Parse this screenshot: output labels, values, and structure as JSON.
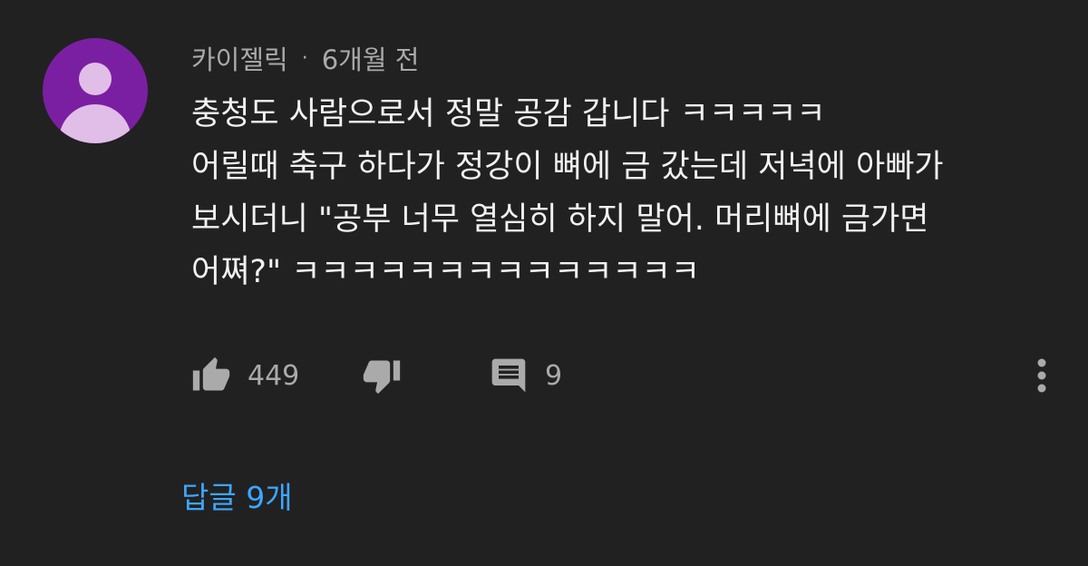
{
  "comment": {
    "author": "카이젤릭",
    "separator": "·",
    "timestamp": "6개월 전",
    "text": "충청도 사람으로서 정말 공감 갑니다 ㅋㅋㅋㅋㅋ\n어릴때 축구 하다가 정강이 뼈에 금 갔는데 저녁에 아빠가\n보시더니 \"공부 너무 열심히 하지 말어. 머리뼈에 금가면\n어쪄?\" ㅋㅋㅋㅋㅋㅋㅋㅋㅋㅋㅋㅋㅋㅋ",
    "avatar_color": "#7b1fa2",
    "avatar_fg": "#e1bee7"
  },
  "actions": {
    "like_icon": "thumbs-up-icon",
    "like_count": "449",
    "dislike_icon": "thumbs-down-icon",
    "reply_icon": "comment-icon",
    "reply_count": "9",
    "more_icon": "more-vertical-icon"
  },
  "replies": {
    "label": "답글 9개",
    "color": "#3ea6ff"
  }
}
